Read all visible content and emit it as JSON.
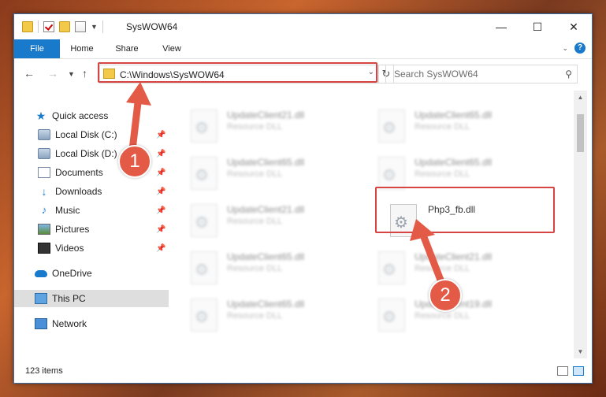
{
  "window": {
    "title": "SysWOW64"
  },
  "ribbon": {
    "tabs": [
      "File",
      "Home",
      "Share",
      "View"
    ],
    "help": "?"
  },
  "address": {
    "path": "C:\\Windows\\SysWOW64"
  },
  "search": {
    "placeholder": "Search SysWOW64"
  },
  "nav": {
    "items": [
      {
        "label": "Quick access"
      },
      {
        "label": "Local Disk (C:)"
      },
      {
        "label": "Local Disk (D:)"
      },
      {
        "label": "Documents"
      },
      {
        "label": "Downloads"
      },
      {
        "label": "Music"
      },
      {
        "label": "Pictures"
      },
      {
        "label": "Videos"
      },
      {
        "label": "OneDrive"
      },
      {
        "label": "This PC"
      },
      {
        "label": "Network"
      }
    ]
  },
  "files": [
    {
      "name": "UpdateClient21.dll",
      "type": "Resource DLL"
    },
    {
      "name": "UpdateClient65.dll",
      "type": "Resource DLL"
    },
    {
      "name": "UpdateClient65.dll",
      "type": "Resource DLL"
    },
    {
      "name": "UpdateClient65.dll",
      "type": "Resource DLL"
    },
    {
      "name": "UpdateClient21.dll",
      "type": "Resource DLL"
    },
    {
      "name": "Php3_fb.dll",
      "type": ""
    },
    {
      "name": "UpdateClient65.dll",
      "type": "Resource DLL"
    },
    {
      "name": "UpdateClient21.dll",
      "type": "Resource DLL"
    },
    {
      "name": "UpdateClient65.dll",
      "type": "Resource DLL"
    },
    {
      "name": "UpdateClient19.dll",
      "type": "Resource DLL"
    }
  ],
  "status": {
    "count": "123 items"
  },
  "callouts": {
    "one": "1",
    "two": "2"
  },
  "colors": {
    "accent": "#1979ca",
    "highlight": "#d64541",
    "callout": "#e35a47"
  }
}
